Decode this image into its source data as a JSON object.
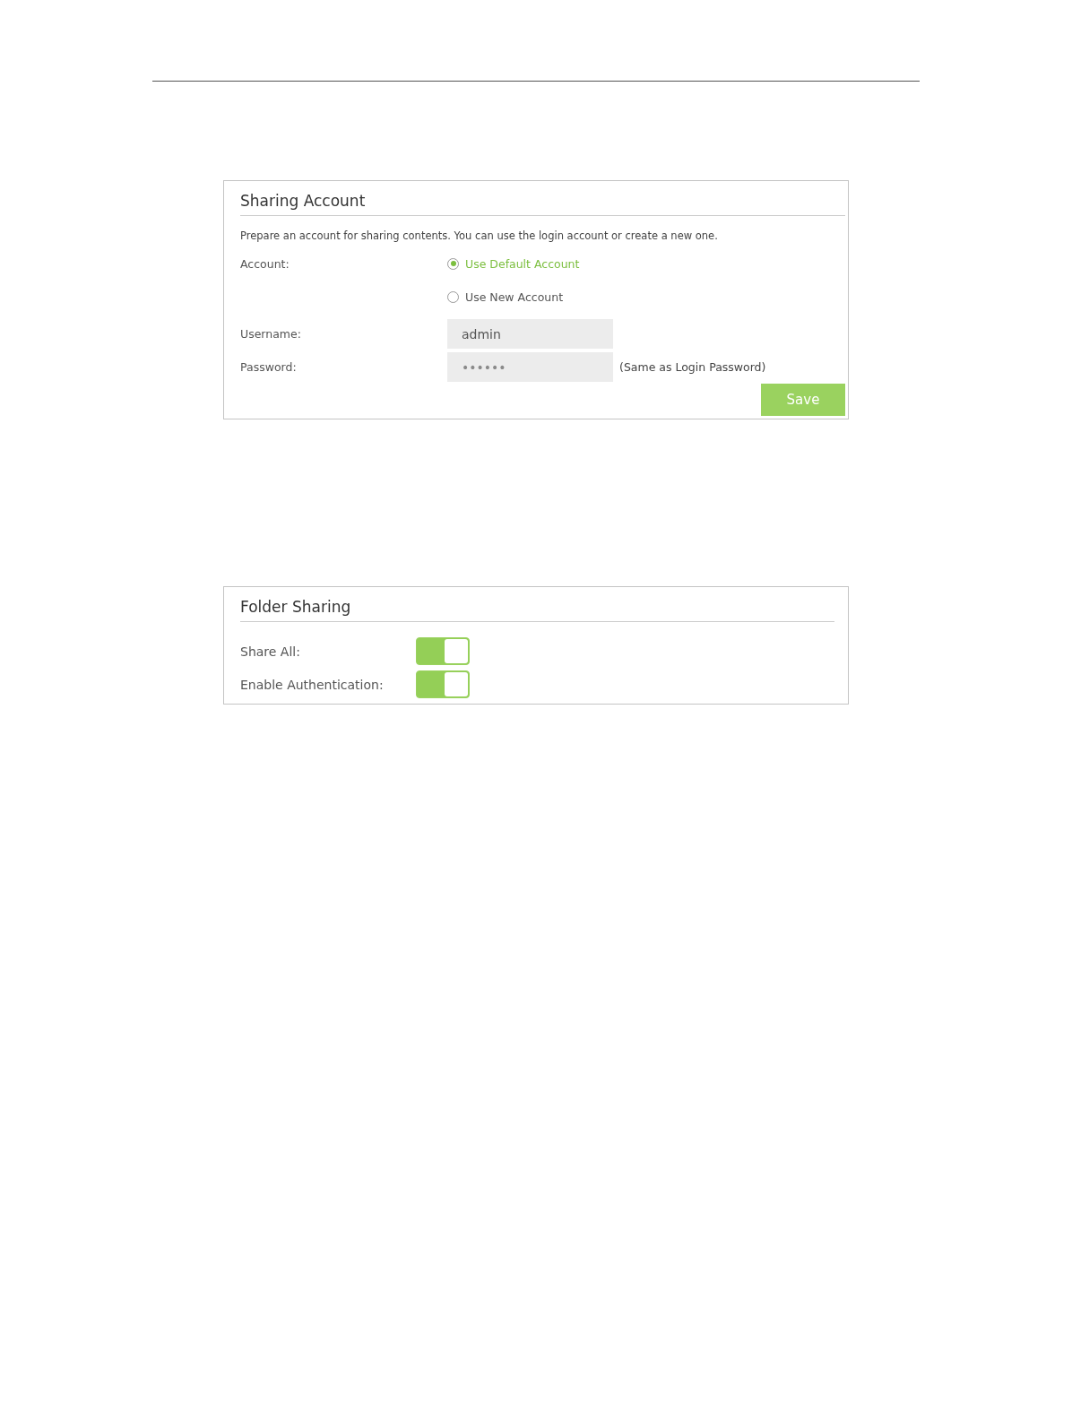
{
  "sharing_account": {
    "title": "Sharing Account",
    "description": "Prepare an account for sharing contents. You can use the login account or create a new one.",
    "account_label": "Account:",
    "account_options": [
      {
        "label": "Use Default Account",
        "selected": true
      },
      {
        "label": "Use New Account",
        "selected": false
      }
    ],
    "username": {
      "label": "Username:",
      "value": "admin"
    },
    "password": {
      "label": "Password:",
      "value": "••••••",
      "note": "(Same as Login Password)"
    },
    "save_button": "Save"
  },
  "folder_sharing": {
    "title": "Folder Sharing",
    "toggles": [
      {
        "label": "Share All:",
        "on": true
      },
      {
        "label": "Enable Authentication:",
        "on": true
      }
    ]
  }
}
